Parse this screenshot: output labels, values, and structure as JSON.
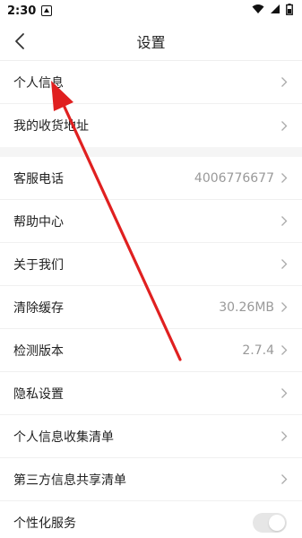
{
  "status_bar": {
    "time": "2:30"
  },
  "header": {
    "title": "设置"
  },
  "section1": [
    {
      "label": "个人信息",
      "value": ""
    },
    {
      "label": "我的收货地址",
      "value": ""
    }
  ],
  "section2": [
    {
      "label": "客服电话",
      "value": "4006776677"
    },
    {
      "label": "帮助中心",
      "value": ""
    },
    {
      "label": "关于我们",
      "value": ""
    },
    {
      "label": "清除缓存",
      "value": "30.26MB"
    },
    {
      "label": "检测版本",
      "value": "2.7.4"
    },
    {
      "label": "隐私设置",
      "value": ""
    },
    {
      "label": "个人信息收集清单",
      "value": ""
    },
    {
      "label": "第三方信息共享清单",
      "value": ""
    }
  ],
  "personalization": {
    "label": "个性化服务",
    "enabled": false
  },
  "colors": {
    "annotation_arrow": "#e02020",
    "chevron": "#aaaaaa",
    "divider": "#f0f0f0",
    "section_gap": "#f5f5f5"
  }
}
